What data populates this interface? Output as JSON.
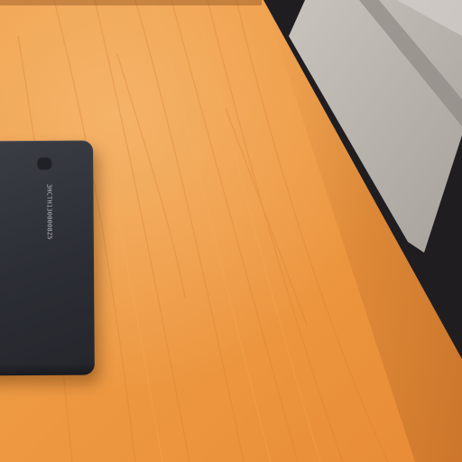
{
  "scene": {
    "colors": {
      "desk_light": "#f0a44d",
      "desk_mid": "#e8913c",
      "desk_dark": "#d97d2f",
      "floor": "#bdb6b0",
      "shadow": "#1f1d1f",
      "device": "#34363d"
    },
    "device": {
      "label_text": "3HCTH1300008Z5"
    }
  }
}
